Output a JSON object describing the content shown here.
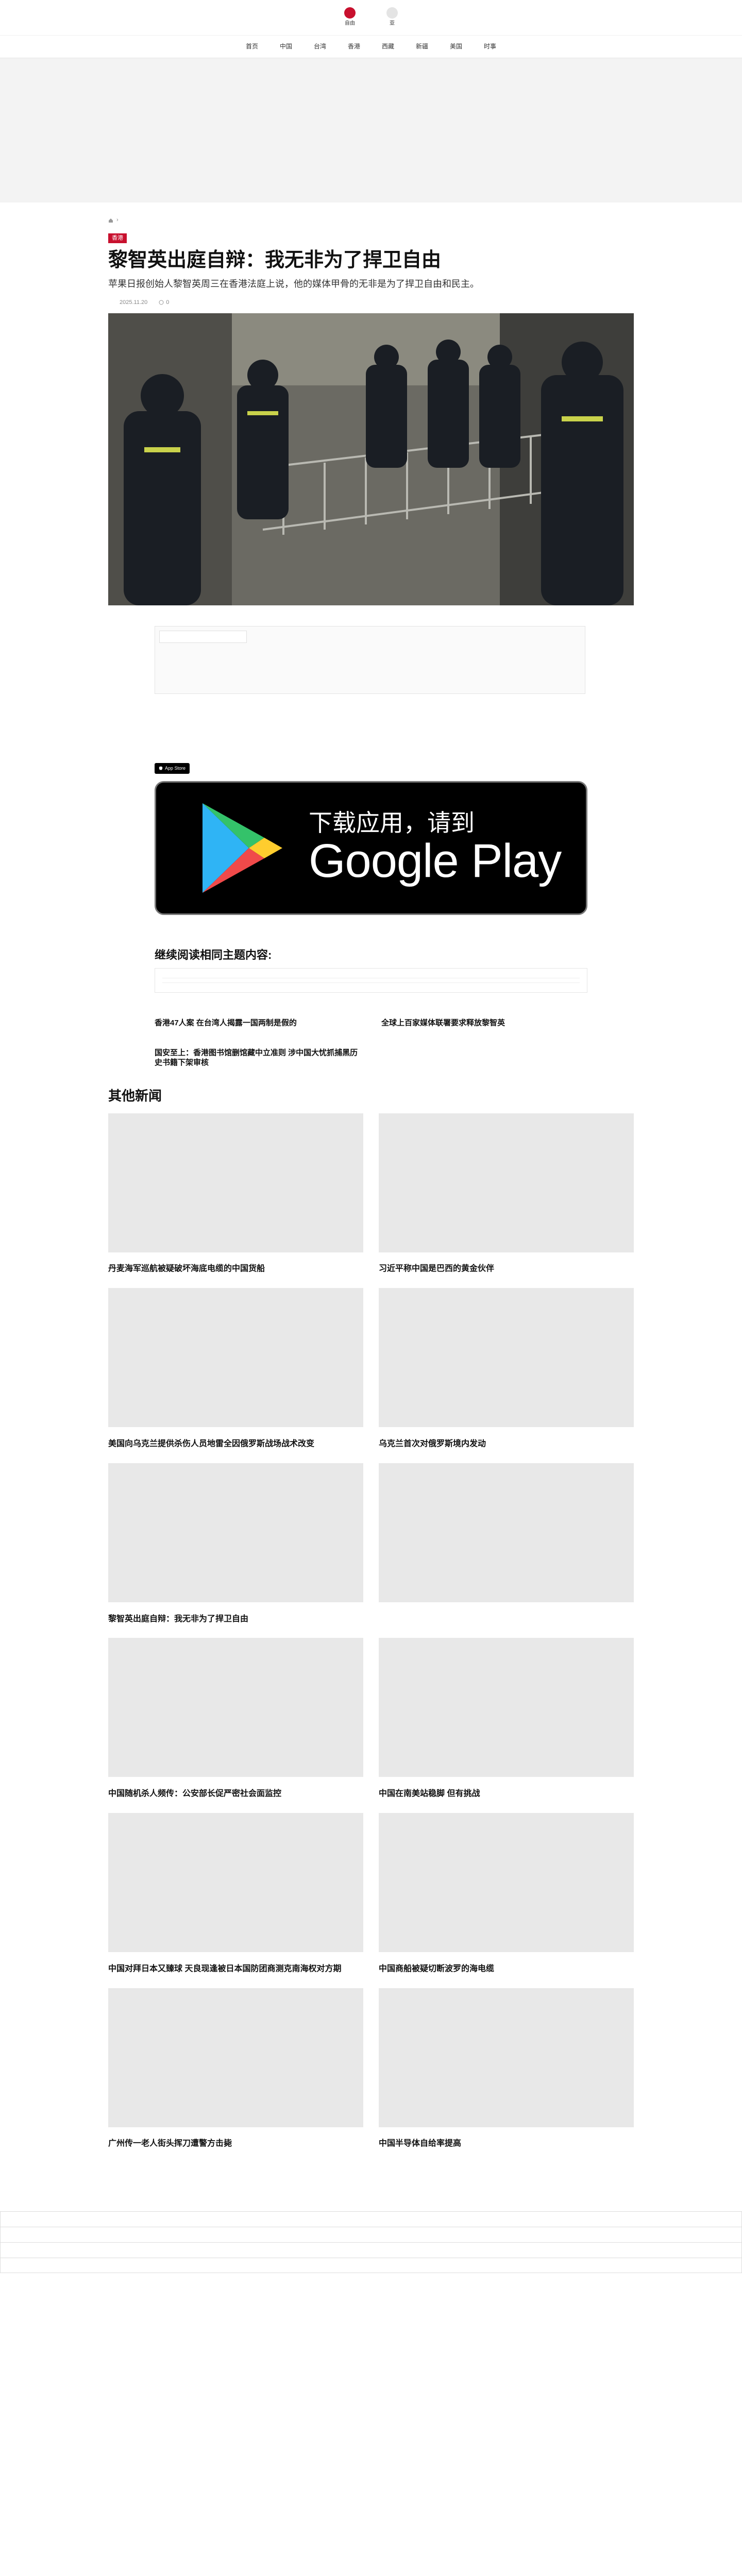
{
  "header": {
    "logo_left": "自由",
    "logo_right": "亚",
    "nav": [
      "首页",
      "中国",
      "台湾",
      "香港",
      "西藏",
      "新疆",
      "美国",
      "时事"
    ]
  },
  "article": {
    "breadcrumb_home": "",
    "breadcrumb_section": "",
    "section_badge": "香港",
    "headline": "黎智英出庭自辩：我无非为了捍卫自由",
    "dek": "苹果日报创始人黎智英周三在香港法庭上说，他的媒体甲骨的无非是为了捍卫自由和民主。",
    "author": "",
    "published": "2025.11.20",
    "comments": "0",
    "hero_caption": "",
    "byline": "",
    "advert_tag": "",
    "paragraphs": [
      "",
      "",
      "",
      "",
      "",
      "",
      "",
      "",
      "",
      "",
      "",
      "",
      "",
      "",
      "",
      "",
      "",
      "",
      "",
      ""
    ],
    "bold_paragraph": "",
    "small_lines": [
      "",
      ""
    ],
    "app_store_label": "App Store",
    "google_play_small": "下载应用，请到",
    "google_play_big": "Google Play",
    "share_label": ""
  },
  "related": {
    "heading": "继续阅读相同主题内容:",
    "topics": [
      "",
      "",
      ""
    ],
    "items": [
      {
        "label": "",
        "badge": "",
        "title": "香港47人案 在台湾人揭露一国两制是假的"
      },
      {
        "label": "",
        "badge": "",
        "title": "全球上百家媒体联署要求释放黎智英"
      },
      {
        "label": "",
        "badge": "",
        "title": "国安至上：香港图书馆删馆藏中立准则 涉中国大忧抓捕黑历史书籍下架审核"
      }
    ]
  },
  "other_news": {
    "heading": "其他新闻",
    "cards": [
      {
        "badge": "",
        "title": "丹麦海军巡航被疑破坏海底电缆的中国货船"
      },
      {
        "badge": "",
        "title": "习近平称中国是巴西的黄金伙伴"
      },
      {
        "badge": "",
        "title": "美国向乌克兰提供杀伤人员地雷全因俄罗斯战场战术改变"
      },
      {
        "badge": "",
        "title": "乌克兰首次对俄罗斯境内发动"
      },
      {
        "badge": "",
        "title": "黎智英出庭自辩：我无非为了捍卫自由"
      },
      {
        "badge": "",
        "title": ""
      },
      {
        "badge": "",
        "title": "中国随机杀人频传：公安部长促严密社会面监控"
      },
      {
        "badge": "",
        "title": "中国在南美站稳脚 但有挑战"
      },
      {
        "badge": "",
        "title": "中国对拜日本又臻球 天良现逢被日本国防团商测克南海权对方期"
      },
      {
        "badge": "",
        "title": "中国商船被疑切断波罗的海电缆"
      },
      {
        "badge": "",
        "title": "广州传一老人街头挥刀遭警方击毙"
      },
      {
        "badge": "",
        "title": "中国半导体自给率提高"
      }
    ]
  },
  "footer": {
    "search_label": "",
    "search_rows": [
      "",
      "",
      "",
      ""
    ],
    "lines": [
      "",
      "",
      "",
      "",
      "",
      "",
      "",
      "",
      "",
      "",
      "",
      "",
      "",
      "",
      "",
      "",
      "",
      "",
      ""
    ],
    "copyright": "",
    "lang_title": "",
    "bottom_notes": [
      "",
      ""
    ]
  },
  "colors": {
    "accent": "#c8102e",
    "text": "#222222",
    "muted": "#888888"
  },
  "icons": {
    "home": "home-icon",
    "comment": "comment-icon",
    "apple": "apple-icon",
    "play": "play-logo-icon"
  }
}
